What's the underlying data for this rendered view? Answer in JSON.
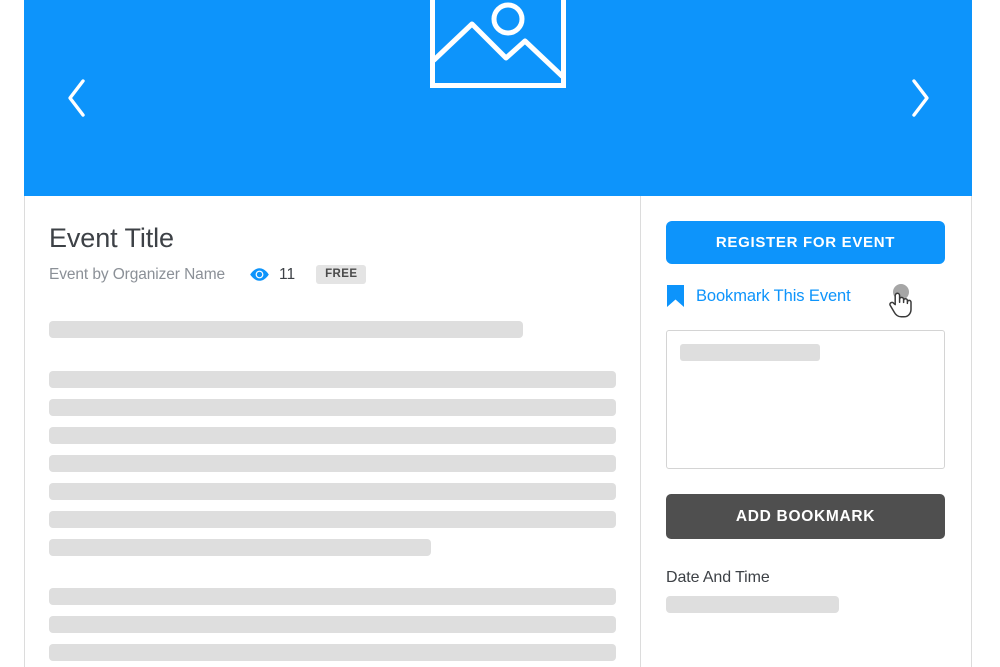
{
  "banner": {
    "prev_icon": "chevron-left-icon",
    "next_icon": "chevron-right-icon",
    "placeholder_icon": "image-placeholder-icon",
    "background_color": "#0d94fb"
  },
  "event": {
    "title": "Event Title",
    "organizer_line": "Event by Organizer Name",
    "views_icon": "eye-icon",
    "views_count": "11",
    "price_badge": "FREE"
  },
  "description_skeletons": {
    "lead_widths": [
      "474px"
    ],
    "paragraph_widths": [
      "100%",
      "100%",
      "100%",
      "100%",
      "100%",
      "100%",
      "382px"
    ],
    "footer_widths": [
      "100%",
      "100%",
      "100%"
    ],
    "color": "#dedede"
  },
  "sidebar": {
    "register_label": "REGISTER FOR EVENT",
    "register_color": "#0d94fb",
    "bookmark_icon": "bookmark-icon",
    "bookmark_label": "Bookmark This Event",
    "bookmark_color": "#0d94fb",
    "note_placeholder_skeleton": true,
    "add_bookmark_label": "ADD BOOKMARK",
    "add_bookmark_color": "#4f4f4f",
    "datetime_label": "Date And Time",
    "datetime_skeleton": true
  },
  "cursor": {
    "icon": "pointing-hand-cursor",
    "click_halo": true
  }
}
